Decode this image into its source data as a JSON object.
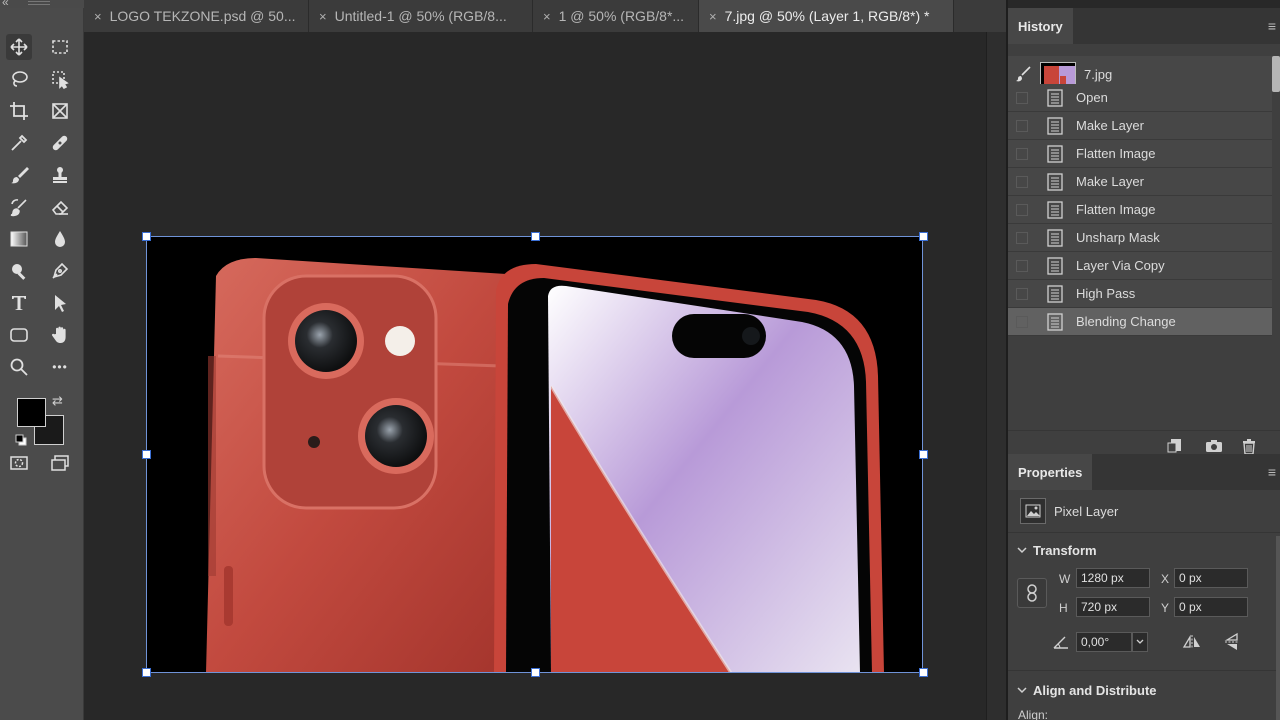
{
  "tabs": [
    {
      "label": "LOGO TEKZONE.psd @ 50...",
      "active": false
    },
    {
      "label": "Untitled-1 @ 50% (RGB/8...",
      "active": false
    },
    {
      "label": "1 @ 50% (RGB/8*...",
      "active": false
    },
    {
      "label": "7.jpg @ 50% (Layer 1, RGB/8*) *",
      "active": true
    }
  ],
  "tab_close_glyph": "×",
  "topstrip_glyph": "«",
  "history": {
    "title": "History",
    "menu_glyph": "≡",
    "snapshot_name": "7.jpg",
    "items": [
      {
        "label": "Open",
        "selected": false
      },
      {
        "label": "Make Layer",
        "selected": false
      },
      {
        "label": "Flatten Image",
        "selected": false
      },
      {
        "label": "Make Layer",
        "selected": false
      },
      {
        "label": "Flatten Image",
        "selected": false
      },
      {
        "label": "Unsharp Mask",
        "selected": false
      },
      {
        "label": "Layer Via Copy",
        "selected": false
      },
      {
        "label": "High Pass",
        "selected": false
      },
      {
        "label": "Blending Change",
        "selected": true
      }
    ]
  },
  "properties": {
    "title": "Properties",
    "menu_glyph": "≡",
    "layer_type": "Pixel Layer",
    "transform_title": "Transform",
    "w_label": "W",
    "w_value": "1280 px",
    "h_label": "H",
    "h_value": "720 px",
    "x_label": "X",
    "x_value": "0 px",
    "y_label": "Y",
    "y_value": "0 px",
    "angle_value": "0,00°",
    "align_title": "Align and Distribute",
    "align_label": "Align:"
  },
  "icons": {
    "swap": "⇄",
    "more": "•••"
  },
  "colors": {
    "foreground": "#000000",
    "background": "#1a1a1a",
    "selection": "#6f93d8",
    "phone_red": "#c8453a",
    "screen_violet": "#b89ad8"
  }
}
